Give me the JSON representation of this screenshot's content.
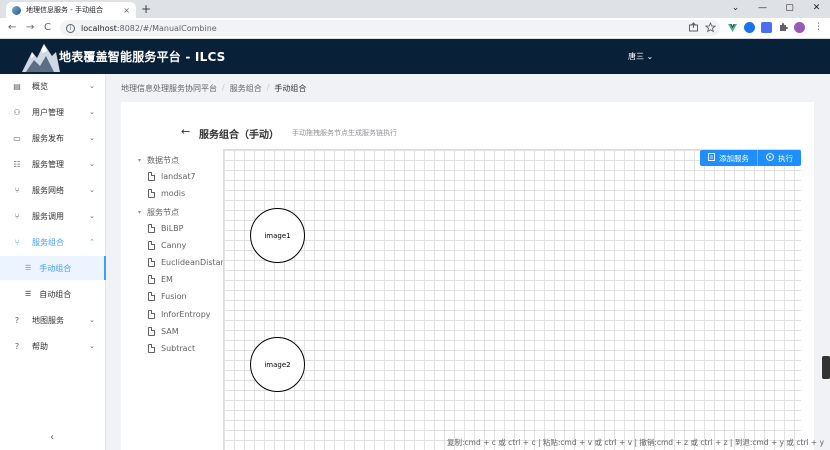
{
  "browser": {
    "tab_title": "地理信息服务 - 手动组合",
    "tab_close": "×",
    "new_tab": "+",
    "url_host": "localhost",
    "url_path": ":8082/#/ManualCombine",
    "back": "←",
    "forward": "→",
    "reload": "C",
    "win_min": "—",
    "win_max": "▢",
    "win_close": "✕",
    "win_chevron": "⌄"
  },
  "header": {
    "title": "地表覆盖智能服务平台 - ILCS",
    "user": "唐三 ⌄"
  },
  "sidebar": {
    "items": [
      {
        "label": "概览",
        "icon": "▤",
        "arrow": "⌄"
      },
      {
        "label": "用户管理",
        "icon": "⚇",
        "arrow": "⌄"
      },
      {
        "label": "服务发布",
        "icon": "▭",
        "arrow": "⌄"
      },
      {
        "label": "服务管理",
        "icon": "☷",
        "arrow": "⌄"
      },
      {
        "label": "服务网络",
        "icon": "⑂",
        "arrow": "⌄"
      },
      {
        "label": "服务调用",
        "icon": "⑂",
        "arrow": "⌄"
      },
      {
        "label": "服务组合",
        "icon": "⑂",
        "arrow": "⌃"
      },
      {
        "label": "地图服务",
        "icon": "?",
        "arrow": "⌄"
      },
      {
        "label": "帮助",
        "icon": "?",
        "arrow": "⌄"
      }
    ],
    "sub_items": [
      {
        "label": "手动组合",
        "icon": "☰"
      },
      {
        "label": "自动组合",
        "icon": "☰"
      }
    ],
    "collapse": "‹"
  },
  "breadcrumb": {
    "items": [
      "地理信息处理服务协同平台",
      "服务组合",
      "手动组合"
    ],
    "sep": "/"
  },
  "page": {
    "back": "←",
    "title": "服务组合（手动）",
    "subtitle": "手动拖拽服务节点生成服务链执行"
  },
  "tree": {
    "data_group": "数据节点",
    "data_items": [
      "landsat7",
      "modis"
    ],
    "service_group": "服务节点",
    "service_items": [
      "BiLBP",
      "Canny",
      "EuclideanDistan",
      "EM",
      "Fusion",
      "InforEntropy",
      "SAM",
      "Subtract"
    ],
    "caret": "▾"
  },
  "canvas": {
    "nodes": [
      {
        "label": "image1"
      },
      {
        "label": "image2"
      }
    ],
    "add_service": "添加服务",
    "execute": "执行",
    "shortcuts": "复制:cmd + c 或 ctrl + c | 粘贴:cmd + v 或 ctrl + v | 撤销:cmd + z 或 ctrl + z | 到退:cmd + y 或 ctrl + y"
  },
  "colors": {
    "header_bg": "#082038",
    "accent": "#409eff",
    "button": "#1f8fff"
  }
}
